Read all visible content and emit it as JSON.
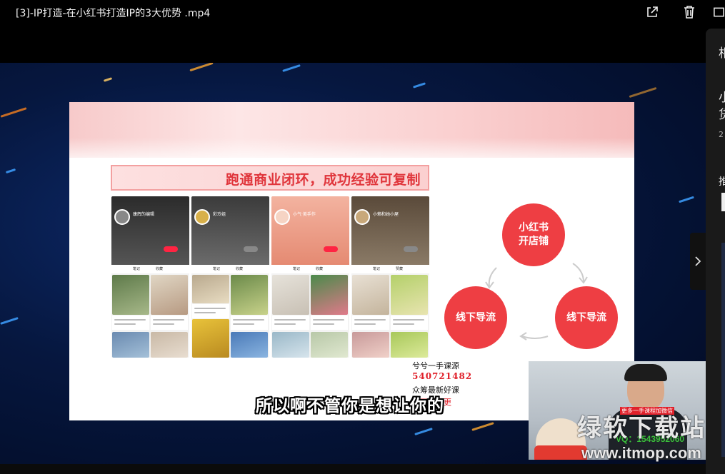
{
  "window": {
    "title": "[3]-IP打造-在小红书打造IP的3大优势 .mp4",
    "icons": [
      "external-open-icon",
      "trash-icon",
      "window-icon"
    ]
  },
  "slide": {
    "banner": "跑通商业闭环，成功经验可复制",
    "phones": [
      {
        "name": "康辉的编辑",
        "tabs": [
          "笔记",
          "收藏"
        ]
      },
      {
        "name": "彩玲姐",
        "tabs": [
          "笔记",
          "收藏"
        ]
      },
      {
        "name": "小气·美手作",
        "tabs": [
          "笔记",
          "收藏"
        ]
      },
      {
        "name": "小赖和她小屋",
        "tabs": [
          "笔记",
          "赞藏"
        ]
      }
    ],
    "diagram": {
      "top": "小红书\n开店铺",
      "left": "线下导流",
      "right": "线下导流"
    }
  },
  "watermark": {
    "line1": "兮兮一手课源",
    "line2": "540721482",
    "line3": "众筹最新好课",
    "line4": "全网持续更"
  },
  "subtitle": "所以啊不管你是想让你的",
  "pip": {
    "banner": "更多一手课程加微信",
    "qq": "VQ：1543952060"
  },
  "site_watermark": {
    "name": "绿软下载站",
    "url": "www.itmop.com"
  },
  "side_panel": {
    "glyphs": [
      "相",
      "小",
      "货",
      "2",
      "推"
    ]
  },
  "colors": {
    "accent_red": "#ee3e43",
    "banner_red": "#e0353b",
    "background_blue": "#06173f"
  }
}
